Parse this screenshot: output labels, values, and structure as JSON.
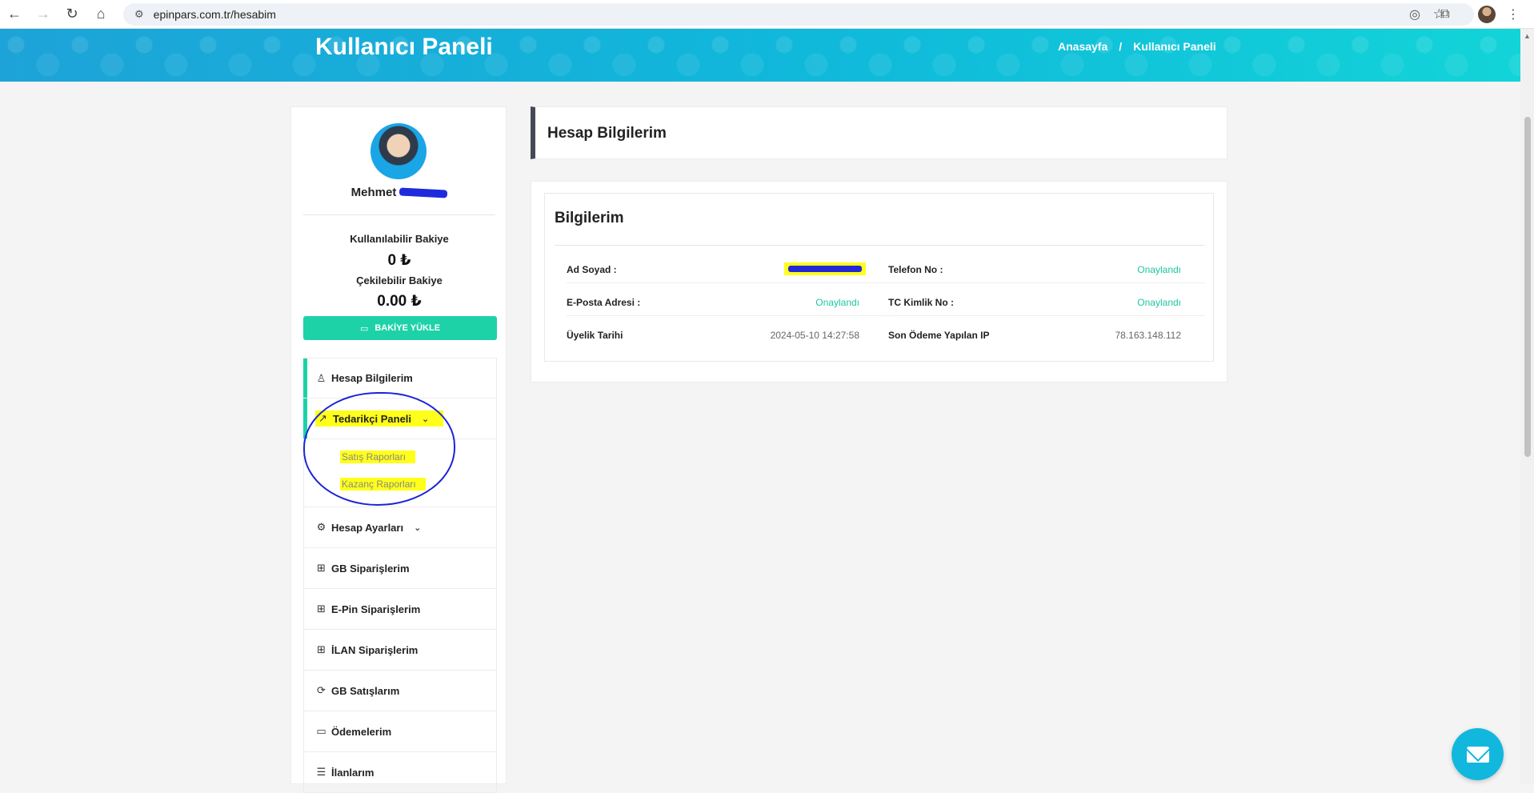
{
  "browser": {
    "back_icon": "←",
    "forward_icon": "→",
    "reload_icon": "↻",
    "home_icon": "⌂",
    "url": "epinpars.com.tr/hesabim",
    "star_icon": "☆"
  },
  "hero": {
    "title": "Kullanıcı Paneli",
    "breadcrumb": [
      "Anasayfa",
      "/",
      "Kullanıcı Paneli"
    ]
  },
  "profile": {
    "first_name": "Mehmet"
  },
  "balance": {
    "available_label": "Kullanılabilir Bakiye",
    "available_value": "0 ₺",
    "withdrawable_label": "Çekilebilir Bakiye",
    "withdrawable_value": "0.00 ₺",
    "load_button": "BAKİYE YÜKLE"
  },
  "menu": {
    "account_info": "Hesap Bilgilerim",
    "supplier_panel": "Tedarikçi Paneli",
    "supplier_sub": [
      "Satış Raporları",
      "Kazanç Raporları"
    ],
    "account_settings": "Hesap Ayarları",
    "gb_orders": "GB Siparişlerim",
    "epin_orders": "E-Pin Siparişlerim",
    "ilan_orders": "İLAN Siparişlerim",
    "gb_sales": "GB Satışlarım",
    "payments": "Ödemelerim",
    "listings": "İlanlarım"
  },
  "page": {
    "heading": "Hesap Bilgilerim",
    "card_title": "Bilgilerim",
    "fields": {
      "name_label": "Ad Soyad :",
      "phone_label": "Telefon No :",
      "phone_value": "Onaylandı",
      "email_label": "E-Posta Adresi :",
      "email_value": "Onaylandı",
      "tc_label": "TC Kimlik No :",
      "tc_value": "Onaylandı",
      "member_label": "Üyelik Tarihi",
      "member_value": "2024-05-10 14:27:58",
      "ip_label": "Son Ödeme Yapılan IP",
      "ip_value": "78.163.148.112"
    }
  },
  "colors": {
    "accent": "#1ed2a8",
    "hero_start": "#1da3d8",
    "hero_end": "#12d4d8",
    "highlight": "#ffff1a",
    "annotation": "#1a23d8"
  }
}
